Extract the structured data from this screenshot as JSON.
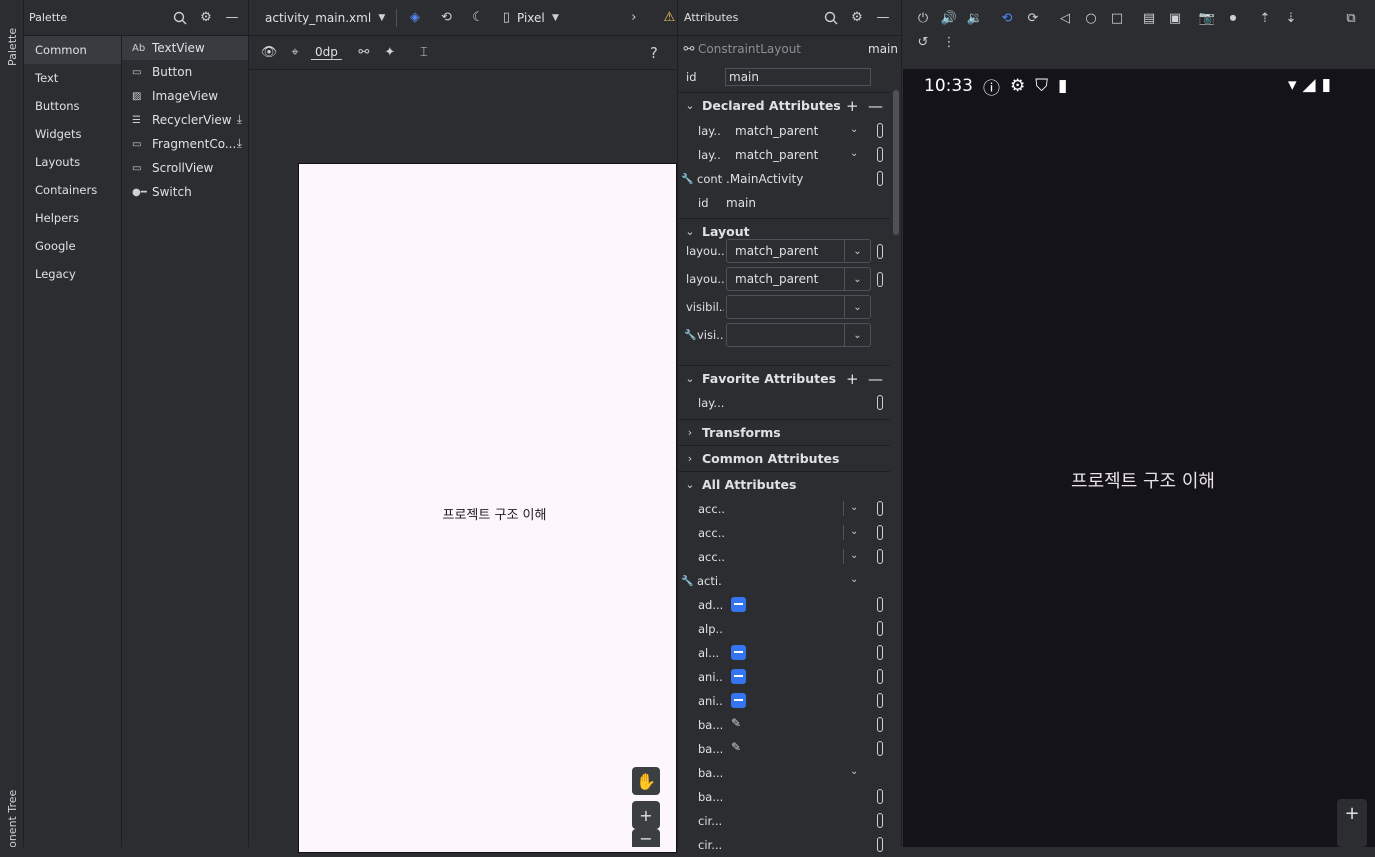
{
  "side_strip": {
    "palette_tab": "Palette",
    "component_tree_tab": "Component Tree"
  },
  "palette": {
    "title": "Palette",
    "categories": [
      "Common",
      "Text",
      "Buttons",
      "Widgets",
      "Layouts",
      "Containers",
      "Helpers",
      "Google",
      "Legacy"
    ],
    "selected_category": "Common",
    "items": [
      {
        "glyph": "Ab",
        "label": "TextView",
        "download": false
      },
      {
        "glyph": "▭",
        "label": "Button",
        "download": false
      },
      {
        "glyph": "▨",
        "label": "ImageView",
        "download": false
      },
      {
        "glyph": "☰",
        "label": "RecyclerView",
        "download": true
      },
      {
        "glyph": "▭",
        "label": "FragmentCo...",
        "download": true
      },
      {
        "glyph": "▭",
        "label": "ScrollView",
        "download": false
      },
      {
        "glyph": "●━",
        "label": "Switch",
        "download": false
      }
    ]
  },
  "design": {
    "file_tab": "activity_main.xml",
    "device": "Pixel",
    "margin_value": "0dp",
    "help": "?",
    "preview_text": "프로젝트 구조 이해"
  },
  "attributes": {
    "title": "Attributes",
    "component": "ConstraintLayout",
    "component_id": "main",
    "id_label": "id",
    "id_value": "main",
    "sections": {
      "declared": "Declared Attributes",
      "layout": "Layout",
      "favorite": "Favorite Attributes",
      "transforms": "Transforms",
      "common": "Common Attributes",
      "all": "All Attributes"
    },
    "declared_rows": [
      {
        "label": "lay...",
        "value": "match_parent"
      },
      {
        "label": "lay...",
        "value": "match_parent"
      },
      {
        "label": "conte",
        "value": ".MainActivity"
      },
      {
        "label": "id",
        "value": "main"
      }
    ],
    "layout_rows": [
      {
        "label": "layou...",
        "value": "match_parent"
      },
      {
        "label": "layou...",
        "value": "match_parent"
      },
      {
        "label": "visibil...",
        "value": ""
      },
      {
        "label": "visi...",
        "value": ""
      }
    ],
    "favorite_rows": [
      {
        "label": "lay..."
      }
    ],
    "all_rows": [
      {
        "label": "acc..."
      },
      {
        "label": "acc..."
      },
      {
        "label": "acc..."
      },
      {
        "label": "acti..."
      },
      {
        "label": "ad..."
      },
      {
        "label": "alp..."
      },
      {
        "label": "al..."
      },
      {
        "label": "ani..."
      },
      {
        "label": "ani..."
      },
      {
        "label": "ba..."
      },
      {
        "label": "ba..."
      },
      {
        "label": "ba..."
      },
      {
        "label": "ba..."
      },
      {
        "label": "cir..."
      },
      {
        "label": "cir..."
      }
    ]
  },
  "emulator": {
    "time": "10:33",
    "screen_text": "프로젝트 구조 이해",
    "zoom_in": "+"
  }
}
